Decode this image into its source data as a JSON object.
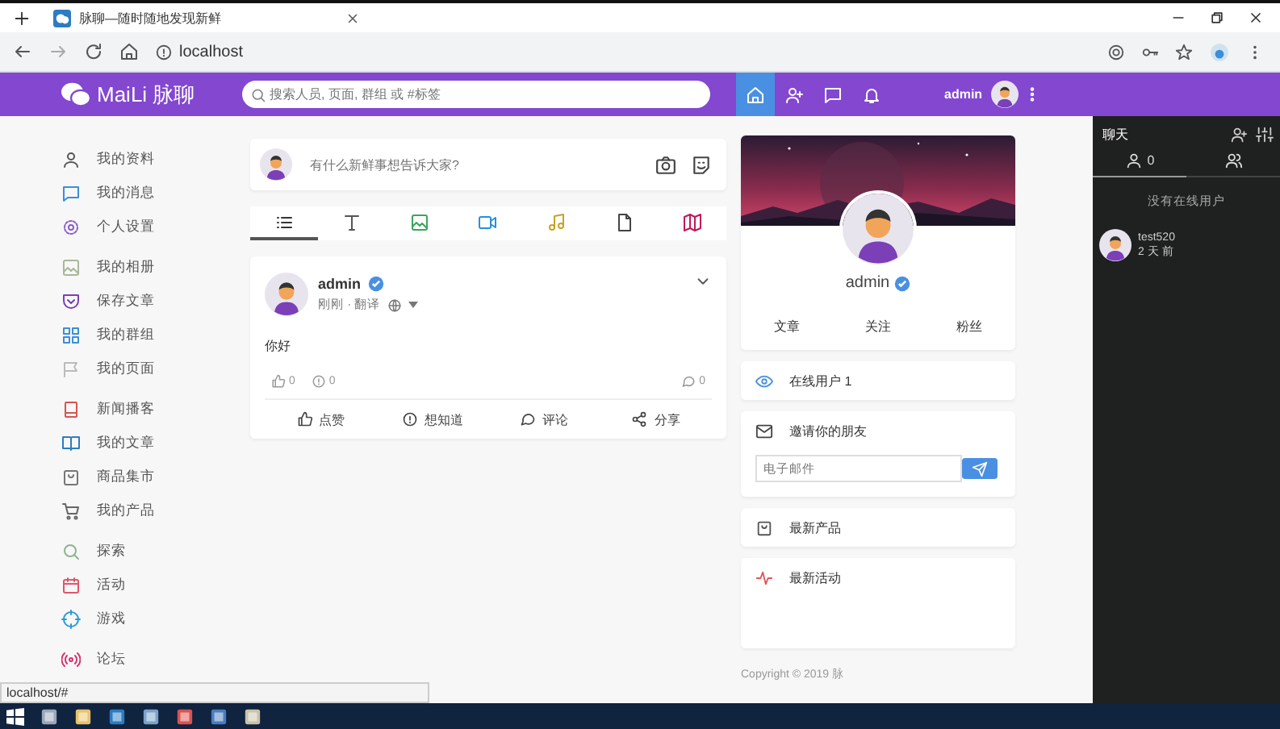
{
  "browser": {
    "tab_title": "脉聊—随时随地发现新鲜",
    "url": "localhost",
    "status_url": "localhost/#"
  },
  "header": {
    "brand": "MaiLi 脉聊",
    "search_placeholder": "搜索人员, 页面, 群组 或 #标签",
    "nav": [
      {
        "selected": true
      },
      {
        "selected": false
      },
      {
        "selected": false
      },
      {
        "selected": false
      }
    ],
    "user": "admin"
  },
  "sidebar": {
    "groups": [
      [
        {
          "label": "我的资料"
        },
        {
          "label": "我的消息"
        },
        {
          "label": "个人设置"
        }
      ],
      [
        {
          "label": "我的相册"
        },
        {
          "label": "保存文章"
        },
        {
          "label": "我的群组"
        },
        {
          "label": "我的页面"
        }
      ],
      [
        {
          "label": "新闻播客"
        },
        {
          "label": "我的文章"
        },
        {
          "label": "商品集市"
        },
        {
          "label": "我的产品"
        }
      ],
      [
        {
          "label": "探索"
        },
        {
          "label": "活动"
        },
        {
          "label": "游戏"
        }
      ],
      [
        {
          "label": "论坛"
        }
      ]
    ]
  },
  "composer": {
    "placeholder": "有什么新鲜事想告诉大家?"
  },
  "post_tabs": [
    {
      "selected": true
    },
    {
      "selected": false
    },
    {
      "selected": false
    },
    {
      "selected": false
    },
    {
      "selected": false
    },
    {
      "selected": false
    },
    {
      "selected": false
    }
  ],
  "post": {
    "author": "admin",
    "verified": true,
    "meta": "刚刚 · 翻译",
    "text": "你好",
    "likes": "0",
    "wonders": "0",
    "comments": "0",
    "actions": [
      "点赞",
      "想知道",
      "评论",
      "分享"
    ]
  },
  "profile": {
    "name": "admin",
    "verified": true,
    "links": [
      "文章",
      "关注",
      "粉丝"
    ]
  },
  "online": {
    "label": "在线用户 1"
  },
  "invite": {
    "title": "邀请你的朋友",
    "placeholder": "电子邮件"
  },
  "widgets": [
    "最新产品",
    "最新活动"
  ],
  "copyright": "Copyright © 2019 脉",
  "chat": {
    "title": "聊天",
    "tabs": [
      {
        "count": "0",
        "selected": true
      },
      {
        "selected": false
      }
    ],
    "empty": "没有在线用户",
    "users": [
      {
        "name": "test520",
        "time": "2 天 前"
      }
    ]
  }
}
